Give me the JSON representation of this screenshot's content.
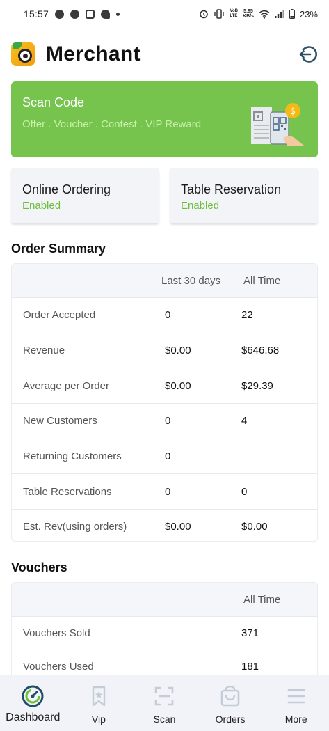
{
  "status_bar": {
    "time": "15:57",
    "battery": "23%",
    "speed_top": "5.85",
    "speed_unit": "KB/s",
    "network_top": "VoB",
    "network_bottom": "LTE"
  },
  "header": {
    "title": "Merchant",
    "logo_icon": "merchant-logo-icon",
    "logout_icon": "logout-icon"
  },
  "scan_card": {
    "title": "Scan Code",
    "subtitle": "Offer . Voucher . Contest . VIP Reward",
    "color": "#76c44d"
  },
  "features": [
    {
      "title": "Online Ordering",
      "status": "Enabled"
    },
    {
      "title": "Table Reservation",
      "status": "Enabled"
    }
  ],
  "order_summary": {
    "heading": "Order Summary",
    "columns": [
      "Last 30 days",
      "All Time"
    ],
    "rows": [
      {
        "label": "Order Accepted",
        "last30": "0",
        "all": "22"
      },
      {
        "label": "Revenue",
        "last30": "$0.00",
        "all": "$646.68"
      },
      {
        "label": "Average per Order",
        "last30": "$0.00",
        "all": "$29.39"
      },
      {
        "label": "New Customers",
        "last30": "0",
        "all": "4"
      },
      {
        "label": "Returning Customers",
        "last30": "0",
        "all": ""
      },
      {
        "label": "Table Reservations",
        "last30": "0",
        "all": "0"
      },
      {
        "label": "Est. Rev(using orders)",
        "last30": "$0.00",
        "all": "$0.00"
      }
    ]
  },
  "vouchers": {
    "heading": "Vouchers",
    "columns": [
      "All Time"
    ],
    "rows": [
      {
        "label": "Vouchers Sold",
        "all": "371"
      },
      {
        "label": "Vouchers Used",
        "all": "181"
      }
    ]
  },
  "bottom_nav": {
    "items": [
      {
        "label": "Dashboard",
        "icon": "dashboard-gauge-icon",
        "active": true
      },
      {
        "label": "Vip",
        "icon": "bookmark-star-icon",
        "active": false
      },
      {
        "label": "Scan",
        "icon": "scan-frame-icon",
        "active": false
      },
      {
        "label": "Orders",
        "icon": "shopping-bag-icon",
        "active": false
      },
      {
        "label": "More",
        "icon": "menu-lines-icon",
        "active": false
      }
    ]
  },
  "colors": {
    "accent_green": "#6cbf3c",
    "nav_active": "#1f4f66",
    "nav_inactive": "#c4cdd6"
  }
}
